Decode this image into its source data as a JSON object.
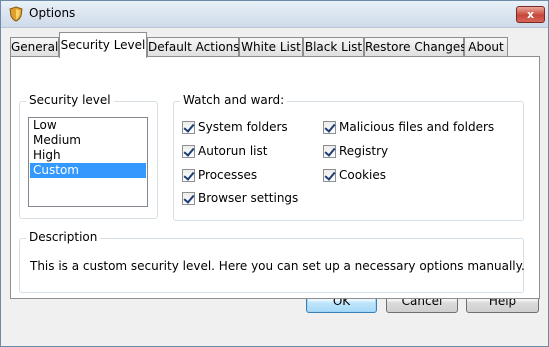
{
  "window": {
    "title": "Options",
    "close_label": "x"
  },
  "tabs": [
    {
      "label": "General"
    },
    {
      "label": "Security Level",
      "active": true
    },
    {
      "label": "Default Actions"
    },
    {
      "label": "White List"
    },
    {
      "label": "Black List"
    },
    {
      "label": "Restore Changes"
    },
    {
      "label": "About"
    }
  ],
  "security_level": {
    "title": "Security level",
    "items": [
      "Low",
      "Medium",
      "High",
      "Custom"
    ],
    "selected": "Custom"
  },
  "watch": {
    "title": "Watch and ward:",
    "left": [
      {
        "label": "System folders",
        "checked": true
      },
      {
        "label": "Autorun list",
        "checked": true
      },
      {
        "label": "Processes",
        "checked": true
      },
      {
        "label": "Browser settings",
        "checked": true
      }
    ],
    "right": [
      {
        "label": "Malicious files and folders",
        "checked": true
      },
      {
        "label": "Registry",
        "checked": true
      },
      {
        "label": "Cookies",
        "checked": true
      }
    ]
  },
  "description": {
    "title": "Description",
    "text": "This is a custom security level. Here you can set up a necessary options manually."
  },
  "buttons": {
    "ok": "OK",
    "cancel": "Cancel",
    "help": "Help"
  },
  "colors": {
    "selection": "#3399ff",
    "titlebar": "#cfdbe9",
    "close": "#c7473a"
  }
}
